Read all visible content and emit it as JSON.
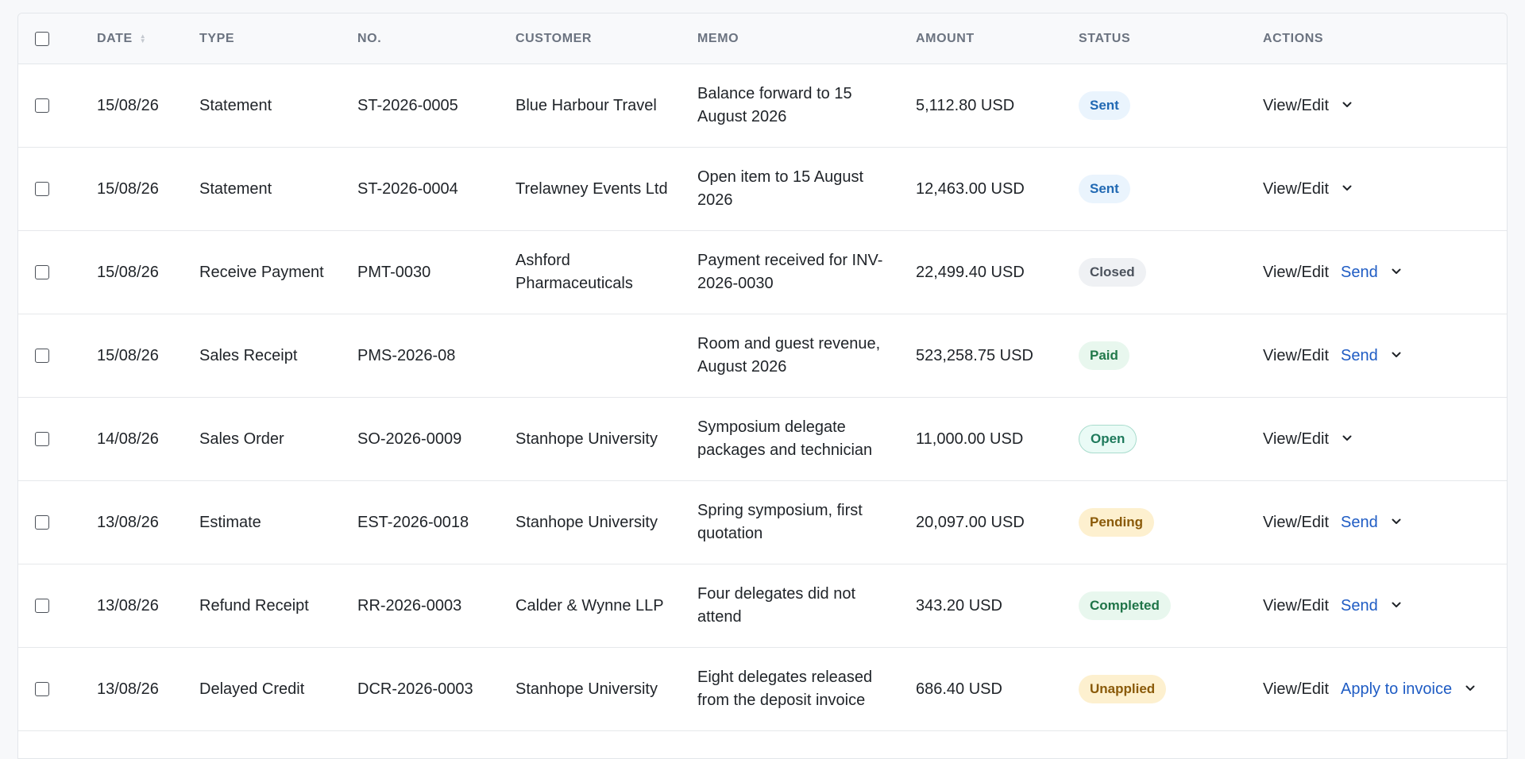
{
  "columns": {
    "date": "DATE",
    "type": "TYPE",
    "no": "NO.",
    "customer": "CUSTOMER",
    "memo": "MEMO",
    "amount": "AMOUNT",
    "status": "STATUS",
    "actions": "ACTIONS"
  },
  "rows": [
    {
      "date": "15/08/26",
      "type": "Statement",
      "no": "ST-2026-0005",
      "customer": "Blue Harbour Travel",
      "memo": "Balance forward to 15 August 2026",
      "amount": "5,112.80 USD",
      "status": "Sent",
      "status_kind": "sent",
      "view": "View/Edit",
      "secondary": ""
    },
    {
      "date": "15/08/26",
      "type": "Statement",
      "no": "ST-2026-0004",
      "customer": "Trelawney Events Ltd",
      "memo": "Open item to 15 August 2026",
      "amount": "12,463.00 USD",
      "status": "Sent",
      "status_kind": "sent",
      "view": "View/Edit",
      "secondary": ""
    },
    {
      "date": "15/08/26",
      "type": "Receive Payment",
      "no": "PMT-0030",
      "customer": "Ashford Pharmaceuticals",
      "memo": "Payment received for INV-2026-0030",
      "amount": "22,499.40 USD",
      "status": "Closed",
      "status_kind": "closed",
      "view": "View/Edit",
      "secondary": "Send"
    },
    {
      "date": "15/08/26",
      "type": "Sales Receipt",
      "no": "PMS-2026-08",
      "customer": "",
      "memo": "Room and guest revenue, August 2026",
      "amount": "523,258.75 USD",
      "status": "Paid",
      "status_kind": "paid",
      "view": "View/Edit",
      "secondary": "Send"
    },
    {
      "date": "14/08/26",
      "type": "Sales Order",
      "no": "SO-2026-0009",
      "customer": "Stanhope University",
      "memo": "Symposium delegate packages and technician",
      "amount": "11,000.00 USD",
      "status": "Open",
      "status_kind": "open",
      "view": "View/Edit",
      "secondary": ""
    },
    {
      "date": "13/08/26",
      "type": "Estimate",
      "no": "EST-2026-0018",
      "customer": "Stanhope University",
      "memo": "Spring symposium, first quotation",
      "amount": "20,097.00 USD",
      "status": "Pending",
      "status_kind": "pending",
      "view": "View/Edit",
      "secondary": "Send"
    },
    {
      "date": "13/08/26",
      "type": "Refund Receipt",
      "no": "RR-2026-0003",
      "customer": "Calder & Wynne LLP",
      "memo": "Four delegates did not attend",
      "amount": "343.20 USD",
      "status": "Completed",
      "status_kind": "completed",
      "view": "View/Edit",
      "secondary": "Send"
    },
    {
      "date": "13/08/26",
      "type": "Delayed Credit",
      "no": "DCR-2026-0003",
      "customer": "Stanhope University",
      "memo": "Eight delegates released from the deposit invoice",
      "amount": "686.40 USD",
      "status": "Unapplied",
      "status_kind": "unapplied",
      "view": "View/Edit",
      "secondary": "Apply to invoice"
    }
  ]
}
